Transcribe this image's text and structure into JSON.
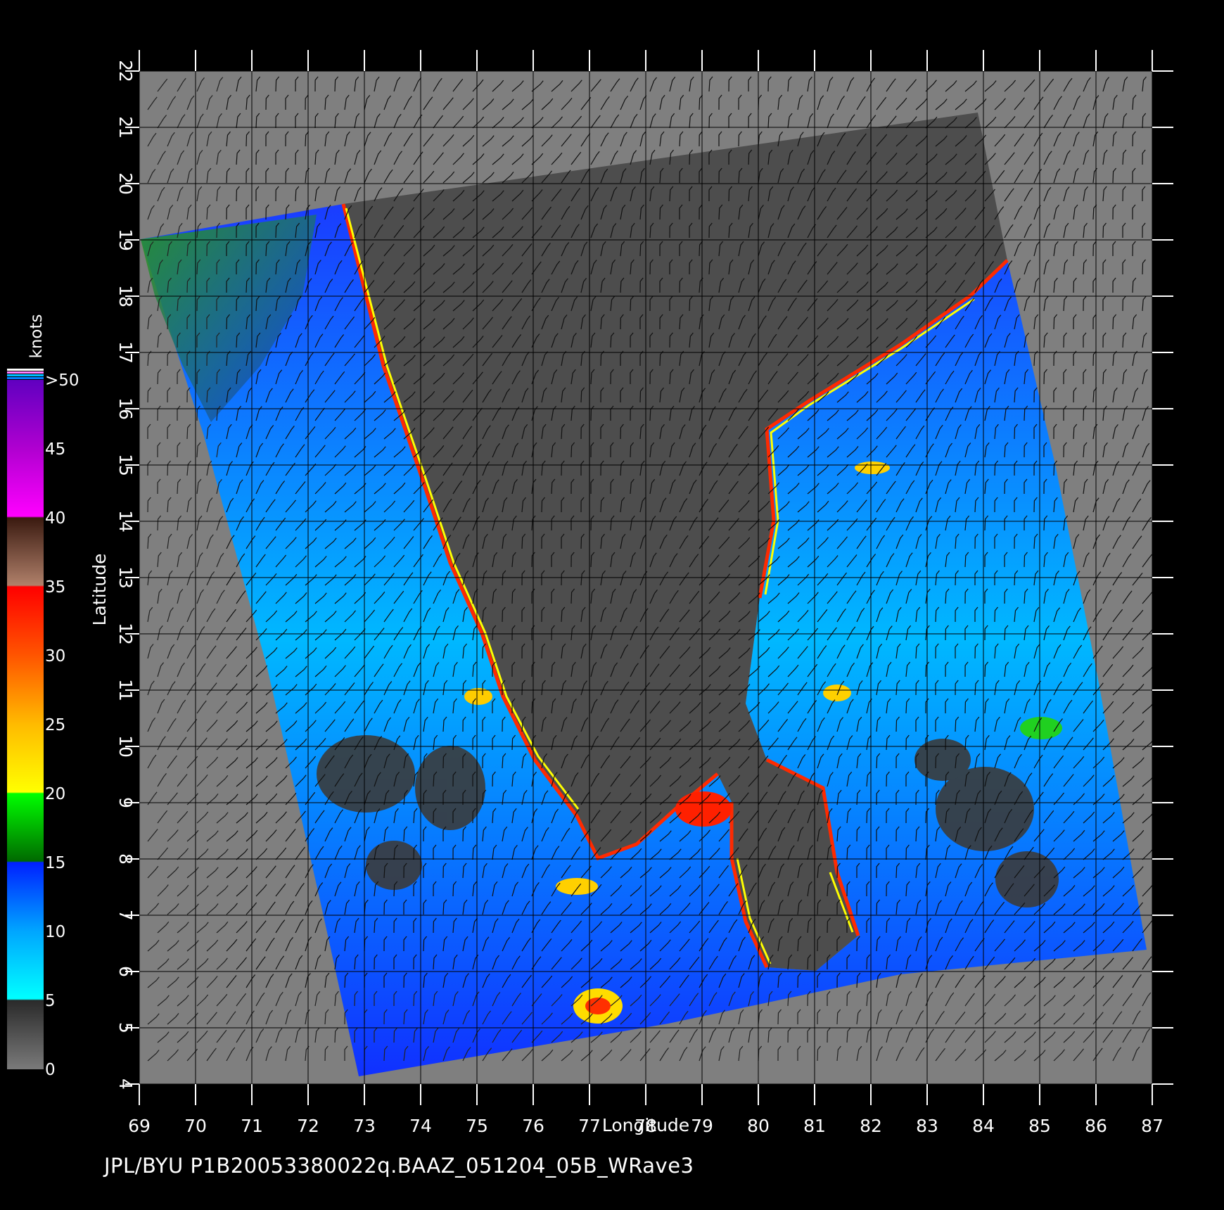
{
  "map": {
    "lon_range": [
      69,
      87
    ],
    "lat_range": [
      4,
      22
    ],
    "lon_ticks": [
      "69",
      "70",
      "71",
      "72",
      "73",
      "74",
      "75",
      "76",
      "77",
      "78",
      "79",
      "80",
      "81",
      "82",
      "83",
      "84",
      "85",
      "86",
      "87"
    ],
    "lat_ticks": [
      "4",
      "5",
      "6",
      "7",
      "8",
      "9",
      "10",
      "11",
      "12",
      "13",
      "14",
      "15",
      "16",
      "17",
      "18",
      "19",
      "20",
      "21",
      "22"
    ],
    "x_label": "Longitude",
    "y_label": "Latitude",
    "background_color": "#7f7f7f",
    "land_color": "#4d4d4d",
    "grid_color": "#000000"
  },
  "colorbar": {
    "title": "knots",
    "labels": [
      ">50",
      "45",
      "40",
      "35",
      "30",
      "25",
      "20",
      "15",
      "10",
      "5",
      "0"
    ],
    "stops": [
      {
        "value": 0,
        "color": "#7a7a7a"
      },
      {
        "value": 5,
        "color": "#2a2a2a"
      },
      {
        "value": 5.1,
        "color": "#00ffff"
      },
      {
        "value": 10,
        "color": "#00a6ff"
      },
      {
        "value": 15,
        "color": "#0020ff"
      },
      {
        "value": 15.1,
        "color": "#006a00"
      },
      {
        "value": 20,
        "color": "#00ff00"
      },
      {
        "value": 20.1,
        "color": "#ffff00"
      },
      {
        "value": 25,
        "color": "#ffbb00"
      },
      {
        "value": 30,
        "color": "#ff5500"
      },
      {
        "value": 35,
        "color": "#ff0000"
      },
      {
        "value": 35.1,
        "color": "#b0806a"
      },
      {
        "value": 40,
        "color": "#3a1a10"
      },
      {
        "value": 40.1,
        "color": "#ff00ff"
      },
      {
        "value": 45,
        "color": "#b000d0"
      },
      {
        "value": 50,
        "color": "#6000c0"
      }
    ]
  },
  "footer": {
    "text": "JPL/BYU  P1B20053380022q.BAAZ_051204_05B_WRave3"
  }
}
